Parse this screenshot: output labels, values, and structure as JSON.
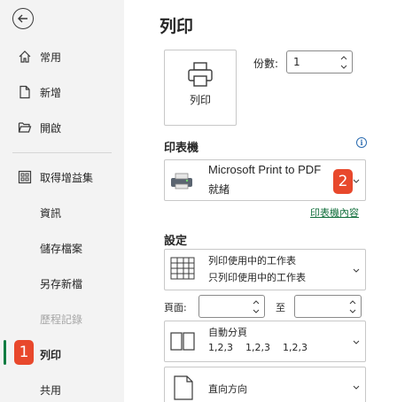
{
  "sidebar": {
    "items": [
      {
        "label": "常用",
        "icon": "home-icon"
      },
      {
        "label": "新增",
        "icon": "new-doc-icon"
      },
      {
        "label": "開啟",
        "icon": "folder-open-icon"
      },
      {
        "label": "取得增益集",
        "icon": "addins-icon"
      },
      {
        "label": "資訊"
      },
      {
        "label": "儲存檔案"
      },
      {
        "label": "另存新檔"
      },
      {
        "label": "歷程記錄",
        "disabled": true
      },
      {
        "label": "列印",
        "active": true
      },
      {
        "label": "共用"
      }
    ],
    "active_badge": "1"
  },
  "main": {
    "title": "列印",
    "print_button_label": "列印",
    "copies_label": "份數:",
    "copies_value": "1",
    "printer_section": "印表機",
    "printer_info_icon": "i",
    "printer_name": "Microsoft Print to PDF",
    "printer_status": "就緒",
    "printer_badge": "2",
    "printer_properties_link": "印表機內容",
    "settings_section": "設定",
    "sheet_scope_title": "列印使用中的工作表",
    "sheet_scope_desc": "只列印使用中的工作表",
    "pages_label": "頁面:",
    "pages_from": "",
    "pages_to_label": "至",
    "pages_to": "",
    "collate_title": "自動分頁",
    "collate_desc": "1,2,3    1,2,3    1,2,3",
    "orientation_title": "直向方向"
  },
  "colors": {
    "sidebar_bg": "#f3f3f3",
    "accent_green": "#107c41",
    "badge_red": "#e8482c"
  }
}
